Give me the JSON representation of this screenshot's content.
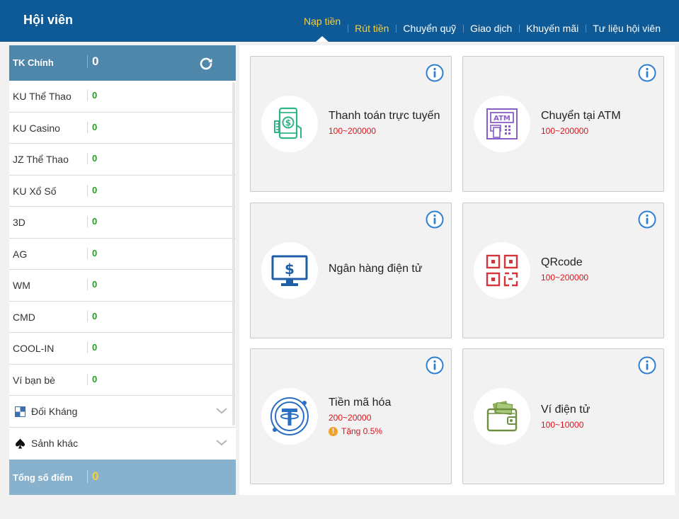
{
  "header": {
    "title": "Hội viên",
    "nav": [
      {
        "label": "Nạp tiền"
      },
      {
        "label": "Rút tiền"
      },
      {
        "label": "Chuyển quỹ"
      },
      {
        "label": "Giao dịch"
      },
      {
        "label": "Khuyến mãi"
      },
      {
        "label": "Tư liệu hội viên"
      }
    ]
  },
  "sidebar": {
    "main_label": "TK Chính",
    "main_value": "0",
    "items": [
      {
        "name": "KU Thể Thao",
        "value": "0"
      },
      {
        "name": "KU Casino",
        "value": "0"
      },
      {
        "name": "JZ Thể Thao",
        "value": "0"
      },
      {
        "name": "KU Xổ Số",
        "value": "0"
      },
      {
        "name": "3D",
        "value": "0"
      },
      {
        "name": "AG",
        "value": "0"
      },
      {
        "name": "WM",
        "value": "0"
      },
      {
        "name": "CMD",
        "value": "0"
      },
      {
        "name": "COOL-IN",
        "value": "0"
      },
      {
        "name": "Ví bạn bè",
        "value": "0"
      }
    ],
    "groups": [
      {
        "name": "Đối Kháng",
        "icon": "checker-icon"
      },
      {
        "name": "Sảnh khác",
        "icon": "spade-icon"
      }
    ],
    "total_label": "Tổng số điểm",
    "total_value": "0"
  },
  "methods": [
    {
      "title": "Thanh toán trực tuyến",
      "range": "100~200000",
      "icon": "mobile-payment-icon"
    },
    {
      "title": "Chuyển tại ATM",
      "range": "100~200000",
      "icon": "atm-icon"
    },
    {
      "title": "Ngân hàng điện tử",
      "icon": "monitor-dollar-icon"
    },
    {
      "title": "QRcode",
      "range": "100~200000",
      "icon": "qrcode-icon"
    },
    {
      "title": "Tiền mã hóa",
      "range": "200~20000",
      "bonus": "Tặng 0.5%",
      "icon": "tether-icon"
    },
    {
      "title": "Ví điện tử",
      "range": "100~10000",
      "icon": "wallet-icon"
    }
  ],
  "colors": {
    "header_bg": "#0e5a96",
    "sidebar_head_bg": "#4f87ab",
    "sidebar_foot_bg": "#87b1cc",
    "accent_yellow": "#f5d03b",
    "value_green": "#1ba31b",
    "range_red": "#d4151b",
    "info_blue": "#2f80d1"
  }
}
